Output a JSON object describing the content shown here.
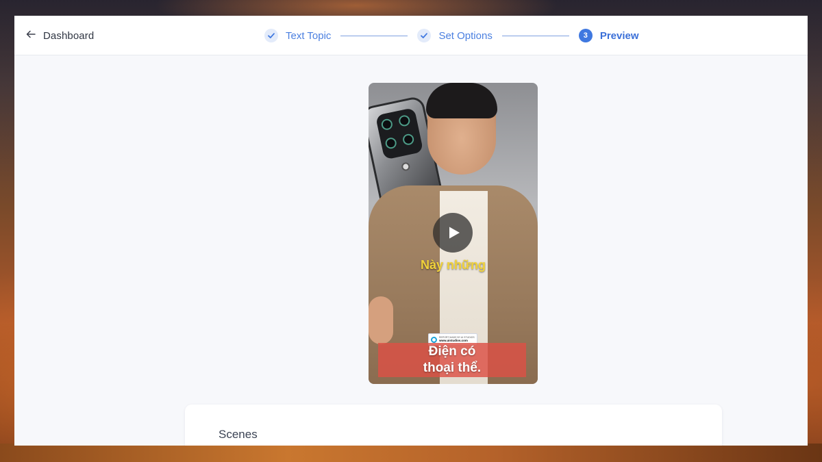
{
  "header": {
    "back_label": "Dashboard",
    "steps": [
      {
        "label": "Text Topic",
        "state": "complete"
      },
      {
        "label": "Set Options",
        "state": "complete"
      },
      {
        "number": "3",
        "label": "Preview",
        "state": "active"
      }
    ]
  },
  "video": {
    "caption_top": "Này những",
    "caption_bottom_line1": "Điện có",
    "caption_bottom_line2": "thoại thể.",
    "watermark_line1": "REPORT MADE BY AI STUDIOS",
    "watermark_line2": "www.aistudios.com"
  },
  "scenes": {
    "title": "Scenes"
  },
  "colors": {
    "accent": "#3f78e0",
    "caption_yellow": "#f1d23a",
    "caption_box": "#dc5046"
  },
  "icons": {
    "back": "arrow-left-icon",
    "step_done": "check-icon",
    "play": "play-icon",
    "watermark": "aistudios-logo-icon"
  }
}
